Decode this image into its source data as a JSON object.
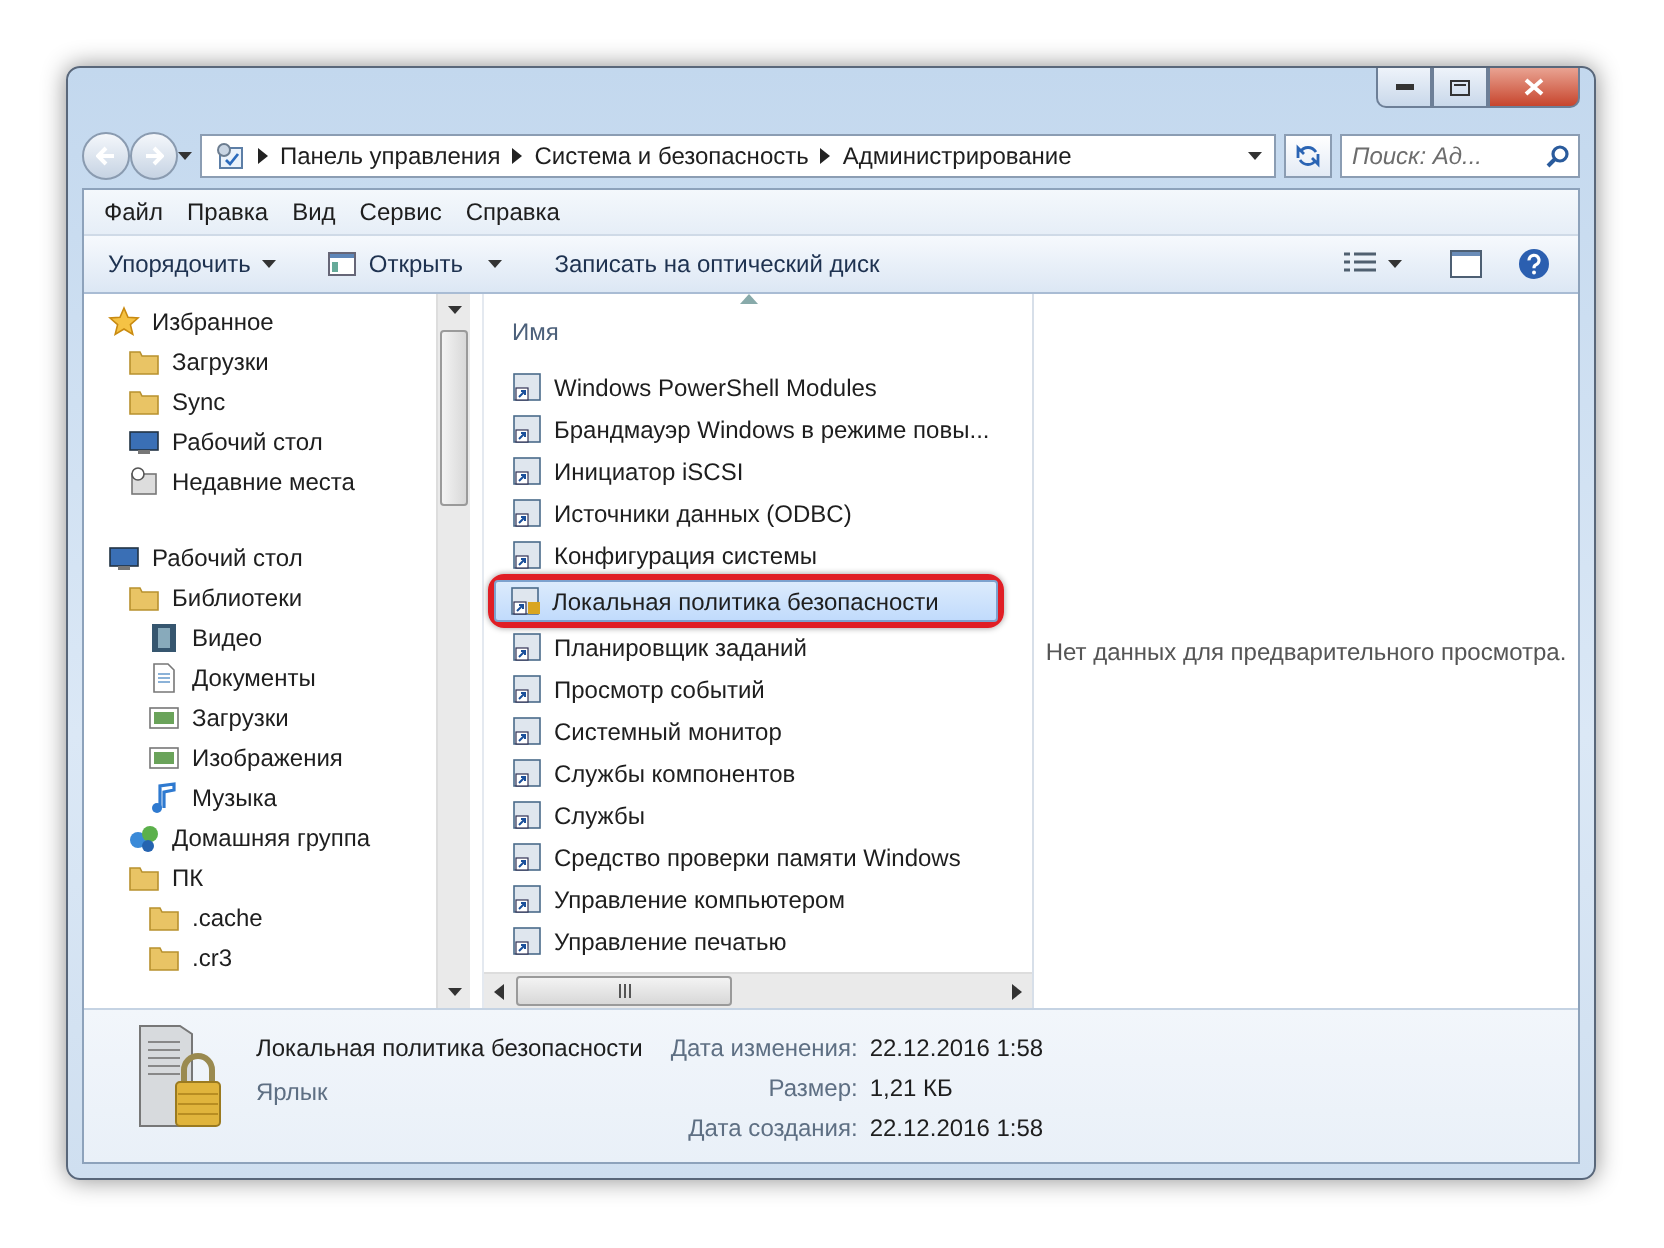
{
  "address": {
    "crumbs": [
      "Панель управления",
      "Система и безопасность",
      "Администрирование"
    ]
  },
  "search": {
    "placeholder": "Поиск: Ад..."
  },
  "menu": [
    "Файл",
    "Правка",
    "Вид",
    "Сервис",
    "Справка"
  ],
  "toolbar": [
    {
      "label": "Упорядочить",
      "kind": "dropdown"
    },
    {
      "label": "Открыть",
      "kind": "split"
    },
    {
      "label": "Записать на оптический диск",
      "kind": "plain"
    }
  ],
  "nav": [
    {
      "label": "Избранное",
      "kind": "star",
      "children": [
        {
          "label": "Загрузки",
          "kind": "folder"
        },
        {
          "label": "Sync",
          "kind": "folder"
        },
        {
          "label": "Рабочий стол",
          "kind": "desktop"
        },
        {
          "label": "Недавние места",
          "kind": "recent"
        }
      ]
    },
    {
      "label": "Рабочий стол",
      "kind": "desktop",
      "children": [
        {
          "label": "Библиотеки",
          "kind": "folder",
          "children": [
            {
              "label": "Видео",
              "kind": "video"
            },
            {
              "label": "Документы",
              "kind": "document"
            },
            {
              "label": "Загрузки",
              "kind": "picture"
            },
            {
              "label": "Изображения",
              "kind": "picture"
            },
            {
              "label": "Музыка",
              "kind": "music"
            }
          ]
        },
        {
          "label": "Домашняя группа",
          "kind": "network"
        },
        {
          "label": "ПК",
          "kind": "folder",
          "children": [
            {
              "label": ".cache",
              "kind": "folder"
            },
            {
              "label": ".cr3",
              "kind": "folder"
            }
          ]
        }
      ]
    }
  ],
  "files": {
    "column": "Имя",
    "items": [
      {
        "label": "Windows PowerShell Modules",
        "selected": false,
        "highlighted": false
      },
      {
        "label": "Брандмауэр Windows в режиме повы...",
        "selected": false,
        "highlighted": false
      },
      {
        "label": "Инициатор iSCSI",
        "selected": false,
        "highlighted": false
      },
      {
        "label": "Источники данных (ODBC)",
        "selected": false,
        "highlighted": false
      },
      {
        "label": "Конфигурация системы",
        "selected": false,
        "highlighted": false
      },
      {
        "label": "Локальная политика безопасности",
        "selected": true,
        "highlighted": true
      },
      {
        "label": "Планировщик заданий",
        "selected": false,
        "highlighted": false
      },
      {
        "label": "Просмотр событий",
        "selected": false,
        "highlighted": false
      },
      {
        "label": "Системный монитор",
        "selected": false,
        "highlighted": false
      },
      {
        "label": "Службы компонентов",
        "selected": false,
        "highlighted": false
      },
      {
        "label": "Службы",
        "selected": false,
        "highlighted": false
      },
      {
        "label": "Средство проверки памяти Windows",
        "selected": false,
        "highlighted": false
      },
      {
        "label": "Управление компьютером",
        "selected": false,
        "highlighted": false
      },
      {
        "label": "Управление печатью",
        "selected": false,
        "highlighted": false
      }
    ]
  },
  "preview": {
    "message": "Нет данных для предварительного просмотра."
  },
  "details": {
    "name": "Локальная политика безопасности",
    "type": "Ярлык",
    "properties": [
      {
        "label": "Дата изменения:",
        "value": "22.12.2016 1:58"
      },
      {
        "label": "Размер:",
        "value": "1,21 КБ"
      },
      {
        "label": "Дата создания:",
        "value": "22.12.2016 1:58"
      }
    ]
  }
}
